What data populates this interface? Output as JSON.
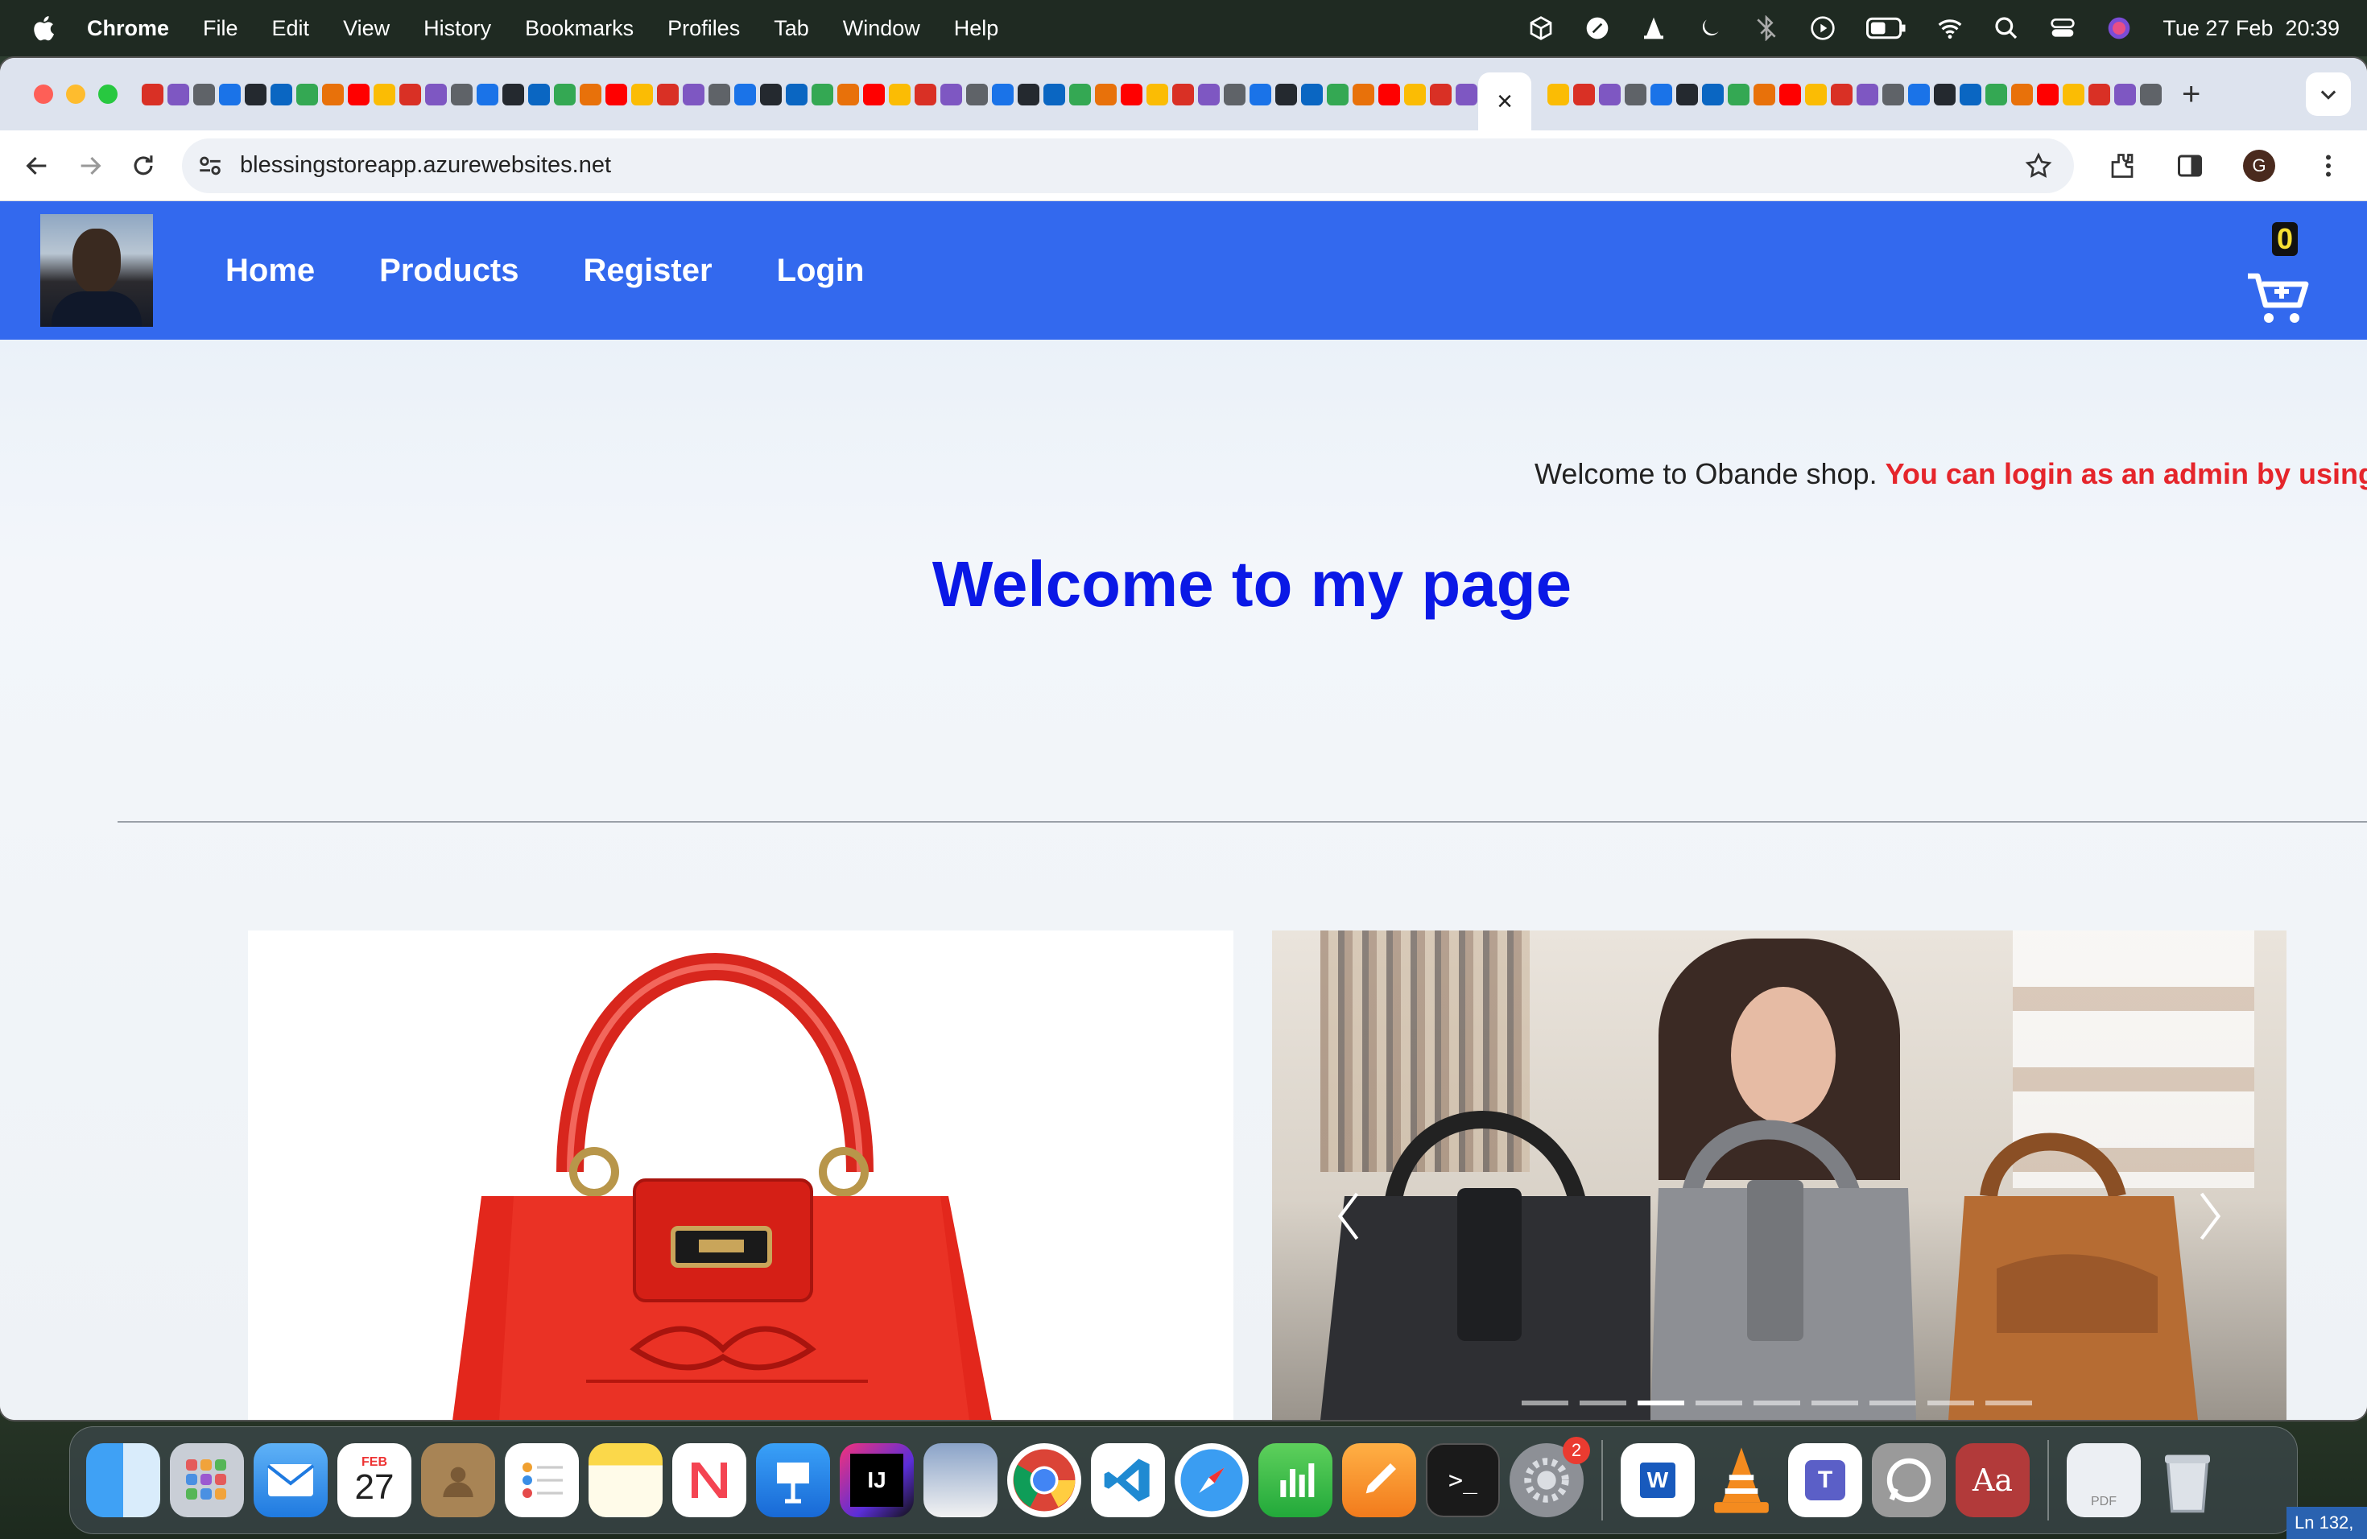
{
  "menubar": {
    "app": "Chrome",
    "items": [
      "File",
      "Edit",
      "View",
      "History",
      "Bookmarks",
      "Profiles",
      "Tab",
      "Window",
      "Help"
    ],
    "clock": "Tue 27 Feb  20:39"
  },
  "browser": {
    "url": "blessingstoreapp.azurewebsites.net",
    "active_tab_close": "×",
    "new_tab": "+",
    "profile_initial": "G"
  },
  "site": {
    "nav": [
      "Home",
      "Products",
      "Register",
      "Login"
    ],
    "cart_count": "0",
    "marquee_text": "Welcome to Obande shop. ",
    "marquee_highlight": "You can login as an admin by using:",
    "hero_title": "Welcome to my page"
  },
  "dock": {
    "calendar_month": "FEB",
    "calendar_day": "27",
    "settings_badge": "2",
    "status_text": "Ln 132,"
  },
  "colors": {
    "nav_bg": "#3369ee",
    "hero_title": "#0a18e6",
    "marquee_highlight": "#e5252b",
    "cart_count": "#f7e034"
  }
}
